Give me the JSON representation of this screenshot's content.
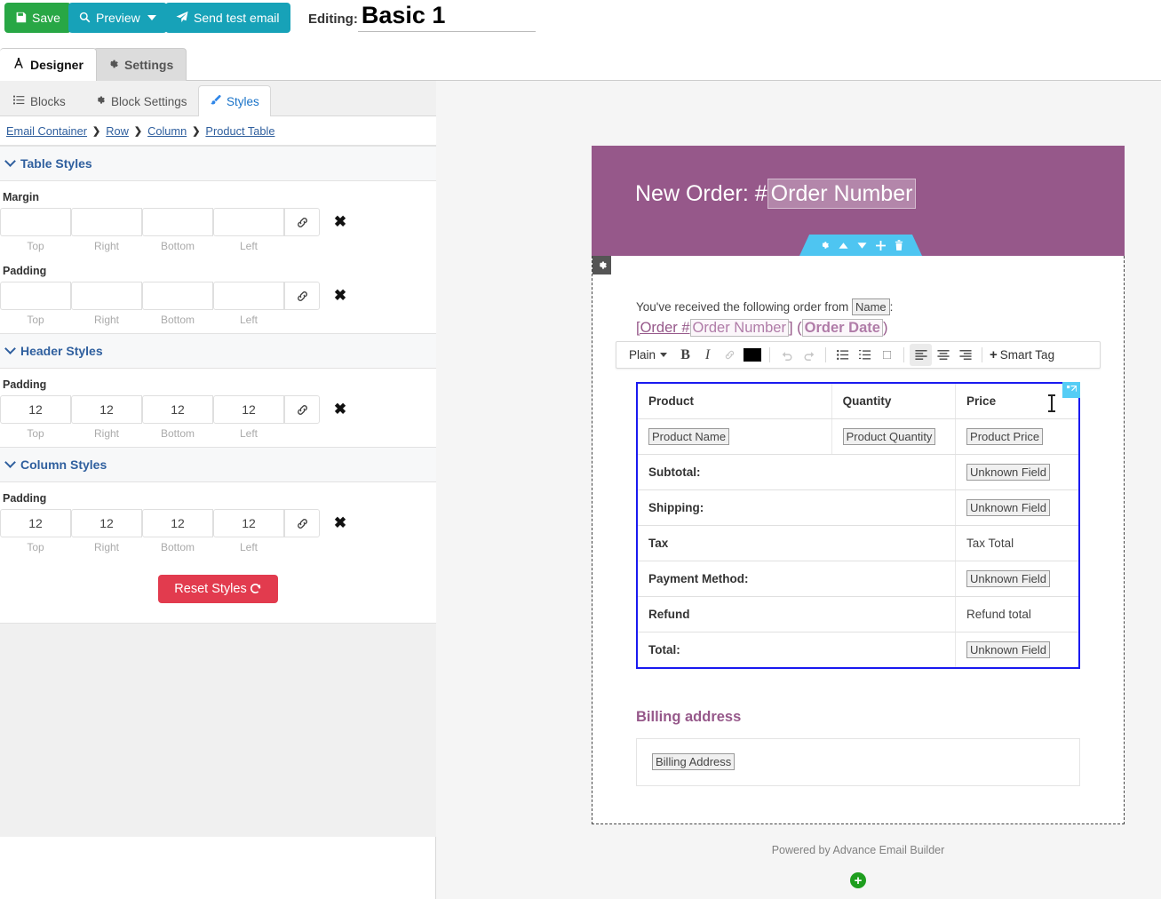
{
  "topbar": {
    "save_label": "Save",
    "preview_label": "Preview",
    "send_test_label": "Send test email",
    "editing_label": "Editing:",
    "editing_value": "Basic 1"
  },
  "primary_tabs": [
    {
      "label": "Designer",
      "icon": "compass-icon",
      "active": true
    },
    {
      "label": "Settings",
      "icon": "gear-icon",
      "active": false
    }
  ],
  "secondary_tabs": [
    {
      "label": "Blocks",
      "icon": "list-icon",
      "active": false
    },
    {
      "label": "Block Settings",
      "icon": "gear-icon",
      "active": false
    },
    {
      "label": "Styles",
      "icon": "brush-icon",
      "active": true
    }
  ],
  "breadcrumb": {
    "items": [
      "Email Container",
      "Row",
      "Column",
      "Product Table"
    ],
    "separator": "❯"
  },
  "style_sections": [
    {
      "title": "Table Styles",
      "fields": [
        {
          "label": "Margin",
          "values": [
            "",
            "",
            "",
            ""
          ],
          "captions": [
            "Top",
            "Right",
            "Bottom",
            "Left"
          ],
          "link_icon": "link-icon",
          "clear_icon": "close-icon"
        },
        {
          "label": "Padding",
          "values": [
            "",
            "",
            "",
            ""
          ],
          "captions": [
            "Top",
            "Right",
            "Bottom",
            "Left"
          ],
          "link_icon": "link-icon",
          "clear_icon": "close-icon"
        }
      ]
    },
    {
      "title": "Header Styles",
      "fields": [
        {
          "label": "Padding",
          "values": [
            "12",
            "12",
            "12",
            "12"
          ],
          "captions": [
            "Top",
            "Right",
            "Bottom",
            "Left"
          ],
          "link_icon": "link-icon",
          "clear_icon": "close-icon"
        }
      ]
    },
    {
      "title": "Column Styles",
      "fields": [
        {
          "label": "Padding",
          "values": [
            "12",
            "12",
            "12",
            "12"
          ],
          "captions": [
            "Top",
            "Right",
            "Bottom",
            "Left"
          ],
          "link_icon": "link-icon",
          "clear_icon": "close-icon"
        }
      ]
    }
  ],
  "reset_button": {
    "label": "Reset Styles",
    "icon": "undo-icon"
  },
  "email": {
    "header_prefix": "New Order: #",
    "header_tag": "Order Number",
    "block_toolbar_icons": [
      "gear-icon",
      "move-up-icon",
      "move-down-icon",
      "add-icon",
      "delete-icon"
    ],
    "body_gear_icon": "gear-icon",
    "intro_pre": "You've received the following order from",
    "intro_tag": "Name",
    "intro_post": ":",
    "order_line": {
      "link_text": "[Order #",
      "tag": "Order Number",
      "mid": "] (",
      "bold_tag": "Order Date",
      "end": ")"
    },
    "table": {
      "headers": [
        "Product",
        "Quantity",
        "Price"
      ],
      "product_row": {
        "name_tag": "Product Name",
        "quantity_tag": "Product Quantity",
        "price_tag": "Product Price"
      },
      "summary_rows": [
        {
          "label": "Subtotal:",
          "value": "Unknown Field",
          "is_tag": true
        },
        {
          "label": "Shipping:",
          "value": "Unknown Field",
          "is_tag": true
        },
        {
          "label": "Tax",
          "value": "Tax Total",
          "is_tag": false
        },
        {
          "label": "Payment Method:",
          "value": "Unknown Field",
          "is_tag": true
        },
        {
          "label": "Refund",
          "value": "Refund total",
          "is_tag": false
        },
        {
          "label": "Total:",
          "value": "Unknown Field",
          "is_tag": true
        }
      ],
      "resize_handle_icon": "resize-handle-icon"
    },
    "billing_heading": "Billing address",
    "billing_tag": "Billing Address",
    "footer_note": "Powered by Advance Email Builder",
    "add_block_icon": "plus-circle-icon"
  },
  "rte_toolbar": {
    "format_label": "Plain",
    "items": [
      {
        "name": "bold-icon",
        "glyph": "B",
        "state": "normal"
      },
      {
        "name": "italic-icon",
        "glyph": "I",
        "state": "normal"
      },
      {
        "name": "link-icon",
        "glyph": "ὑ7",
        "state": "disabled"
      },
      {
        "name": "text-color-icon",
        "glyph": "",
        "state": "normal"
      },
      {
        "name": "undo-icon",
        "glyph": "↶",
        "state": "disabled"
      },
      {
        "name": "redo-icon",
        "glyph": "↷",
        "state": "disabled"
      },
      {
        "name": "bullet-list-icon",
        "glyph": "",
        "state": "normal"
      },
      {
        "name": "numbered-list-icon",
        "glyph": "",
        "state": "normal"
      },
      {
        "name": "blockquote-icon",
        "glyph": "□",
        "state": "normal"
      },
      {
        "name": "align-left-icon",
        "glyph": "",
        "state": "active"
      },
      {
        "name": "align-center-icon",
        "glyph": "",
        "state": "normal"
      },
      {
        "name": "align-right-icon",
        "glyph": "",
        "state": "normal"
      }
    ],
    "smart_tag_label": "Smart Tag",
    "smart_tag_plus": "+"
  },
  "colors": {
    "save_green": "#28a745",
    "teal": "#17a2b8",
    "reset_red": "#e23b4e",
    "brand_purple": "#96588a",
    "toolbar_blue": "#4ec5f1",
    "link_blue": "#2f5f9e",
    "table_outline": "#1a1af0"
  }
}
